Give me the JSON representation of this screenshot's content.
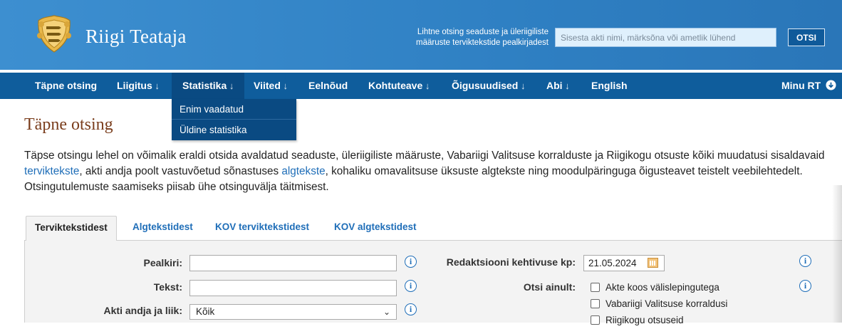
{
  "header": {
    "site_title": "Riigi Teataja",
    "search_hint": "Lihtne otsing seaduste ja üleriigiliste määruste terviktekstide pealkirjadest",
    "search_placeholder": "Sisesta akti nimi, märksõna või ametlik lühend",
    "search_button": "OTSI"
  },
  "nav": {
    "items": [
      {
        "label": "Täpne otsing",
        "arrow": ""
      },
      {
        "label": "Liigitus",
        "arrow": " ↓"
      },
      {
        "label": "Statistika",
        "arrow": " ↓"
      },
      {
        "label": "Viited",
        "arrow": " ↓"
      },
      {
        "label": "Eelnõud",
        "arrow": ""
      },
      {
        "label": "Kohtuteave",
        "arrow": " ↓"
      },
      {
        "label": "Õigusuudised",
        "arrow": " ↓"
      },
      {
        "label": "Abi",
        "arrow": " ↓"
      },
      {
        "label": "English",
        "arrow": ""
      }
    ],
    "account": "Minu RT",
    "dropdown": [
      "Enim vaadatud",
      "Üldine statistika"
    ]
  },
  "page": {
    "title": "Täpne otsing",
    "intro_1": "Täpse otsingu lehel on võimalik eraldi otsida avaldatud seaduste, üleriigiliste määruste, Vabariigi Valitsuse korralduste ja Riigikogu otsuste kõiki muudatusi sisaldavaid ",
    "intro_link_1": "terviktekste",
    "intro_2": ", akti andja poolt vastuvõetud sõnastuses ",
    "intro_link_2": "algtekste",
    "intro_3": ", kohaliku omavalitsuse üksuste algtekste ning moodulpäringuga õigusteavet teistelt veebilehtedelt. Otsingutulemuste saamiseks piisab ühe otsinguvälja täitmisest."
  },
  "tabs": [
    "Terviktekstidest",
    "Algtekstidest",
    "KOV terviktekstidest",
    "KOV algtekstidest"
  ],
  "form": {
    "pealkiri_label": "Pealkiri:",
    "tekst_label": "Tekst:",
    "akti_andja_label": "Akti andja ja liik:",
    "akti_andja_value": "Kõik",
    "redaktsioon_label": "Redaktsiooni kehtivuse kp:",
    "redaktsioon_value": "21.05.2024",
    "otsi_ainult_label": "Otsi ainult:",
    "checkboxes": [
      "Akte koos välislepingutega",
      "Vabariigi Valitsuse korraldusi",
      "Riigikogu otsuseid"
    ],
    "info_glyph": "i"
  },
  "colors": {
    "header_blue": "#2f80c3",
    "nav_blue": "#0f5d9c",
    "title_brown": "#7a3d1c",
    "link_blue": "#1f6eb8"
  }
}
